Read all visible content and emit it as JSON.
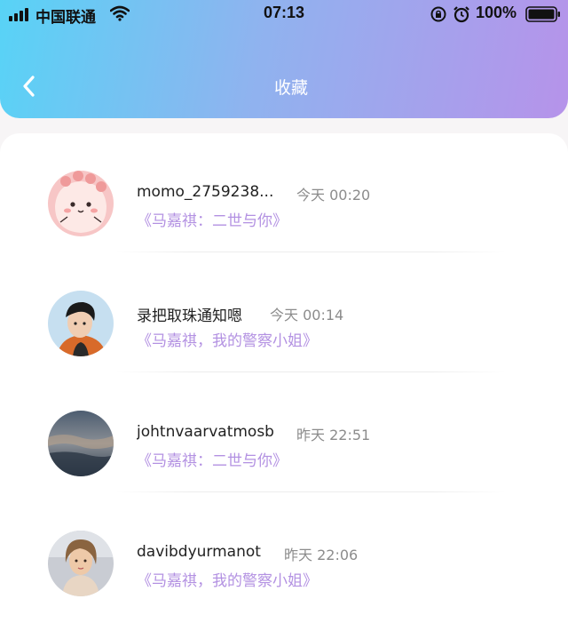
{
  "status_bar": {
    "carrier": "中国联通",
    "time": "07:13",
    "battery": "100%"
  },
  "header": {
    "title": "收藏"
  },
  "items": [
    {
      "username": "momo_2759238...",
      "timestamp": "今天 00:20",
      "book": "《马嘉祺：二世与你》"
    },
    {
      "username": "录把取珠通知嗯",
      "timestamp": "今天 00:14",
      "book": "《马嘉祺，我的警察小姐》"
    },
    {
      "username": "johtnvaarvatmosb",
      "timestamp": "昨天 22:51",
      "book": "《马嘉祺：二世与你》"
    },
    {
      "username": "davibdyurmanot",
      "timestamp": "昨天 22:06",
      "book": "《马嘉祺，我的警察小姐》"
    }
  ],
  "colors": {
    "header_gradient_start": "#58d3f6",
    "header_gradient_end": "#b693ea",
    "book_title": "#b391e2",
    "timestamp": "#8c8c8c"
  },
  "icons": [
    "signal-icon",
    "wifi-icon",
    "rotation-lock-icon",
    "alarm-icon",
    "battery-icon",
    "back-chevron-icon"
  ]
}
